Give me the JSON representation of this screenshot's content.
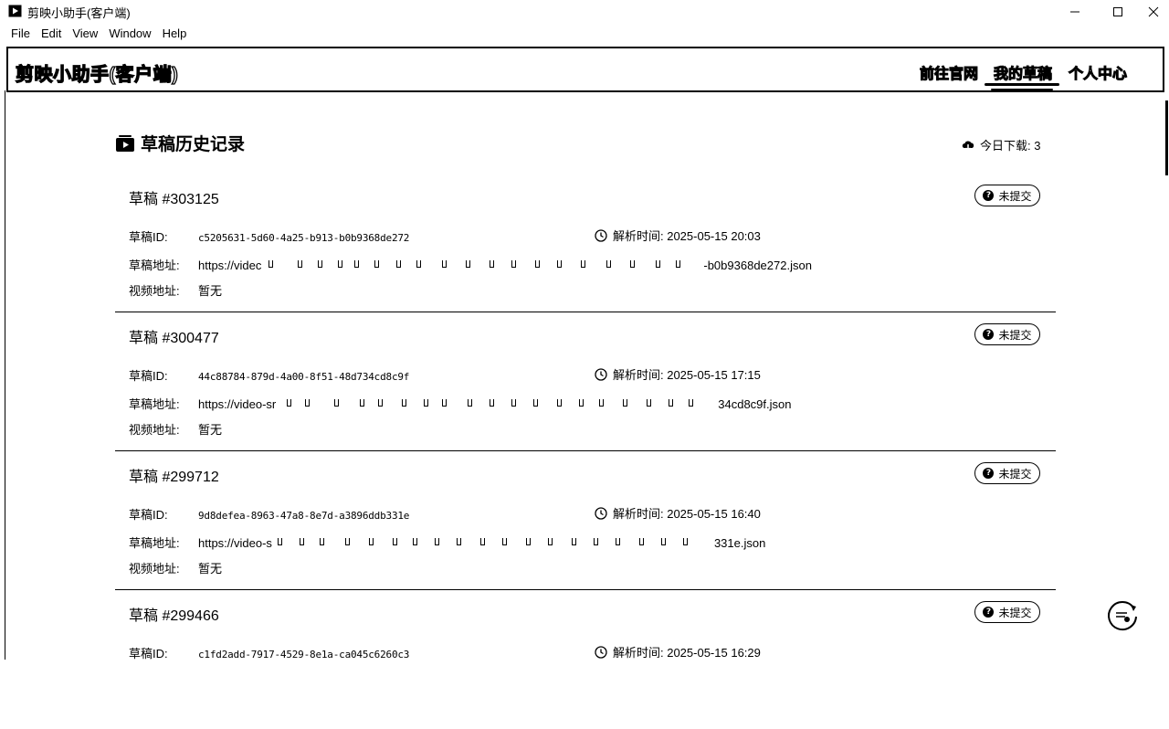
{
  "window": {
    "title": "剪映小助手(客户端)"
  },
  "menu": [
    "File",
    "Edit",
    "View",
    "Window",
    "Help"
  ],
  "header": {
    "app_title": "剪映小助手(客户端)",
    "nav": {
      "official": "前往官网",
      "drafts": "我的草稿",
      "profile": "个人中心"
    }
  },
  "section": {
    "title": "草稿历史记录",
    "download_label": "今日下载: 3"
  },
  "labels": {
    "draft_id": "草稿ID:",
    "draft_url": "草稿地址:",
    "video_url": "视频地址:",
    "parse_time_prefix": "解析时间: "
  },
  "drafts": [
    {
      "title": "草稿 #303125",
      "status": "未提交",
      "id": "c5205631-5d60-4a25-b913-b0b9368de272",
      "time": "解析时间: 2025-05-15 20:03",
      "url_start": "https://videc",
      "url_end": "-b0b9368de272.json",
      "video": "暂无"
    },
    {
      "title": "草稿 #300477",
      "status": "未提交",
      "id": "44c88784-879d-4a00-8f51-48d734cd8c9f",
      "time": "解析时间: 2025-05-15 17:15",
      "url_start": "https://video-sr",
      "url_end": "34cd8c9f.json",
      "video": "暂无"
    },
    {
      "title": "草稿 #299712",
      "status": "未提交",
      "id": "9d8defea-8963-47a8-8e7d-a3896ddb331e",
      "time": "解析时间: 2025-05-15 16:40",
      "url_start": "https://video-s",
      "url_end": "331e.json",
      "video": "暂无"
    },
    {
      "title": "草稿 #299466",
      "status": "未提交",
      "id": "c1fd2add-7917-4529-8e1a-ca045c6260c3",
      "time": "解析时间: 2025-05-15 16:29",
      "url_start": "",
      "url_end": "",
      "video": ""
    }
  ]
}
